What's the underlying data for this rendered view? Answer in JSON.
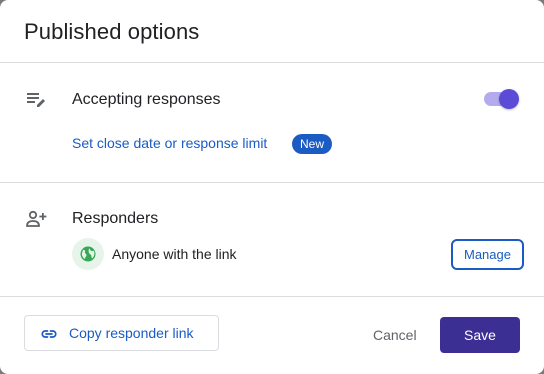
{
  "dialog": {
    "title": "Published options"
  },
  "accepting": {
    "icon": "list-edit-icon",
    "label": "Accepting responses",
    "toggle_on": true,
    "close_date_link": "Set close date or response limit",
    "new_badge": "New"
  },
  "responders": {
    "icon": "person-add-icon",
    "label": "Responders",
    "access_icon": "globe-icon",
    "access_text": "Anyone with the link",
    "manage_label": "Manage"
  },
  "footer": {
    "copy_icon": "link-icon",
    "copy_label": "Copy responder link",
    "cancel_label": "Cancel",
    "save_label": "Save"
  },
  "colors": {
    "accent": "#3c2f94",
    "link": "#1a5bc4",
    "toggle_thumb": "#5b4bd6",
    "toggle_track": "#b4abef",
    "globe": "#34a853"
  }
}
